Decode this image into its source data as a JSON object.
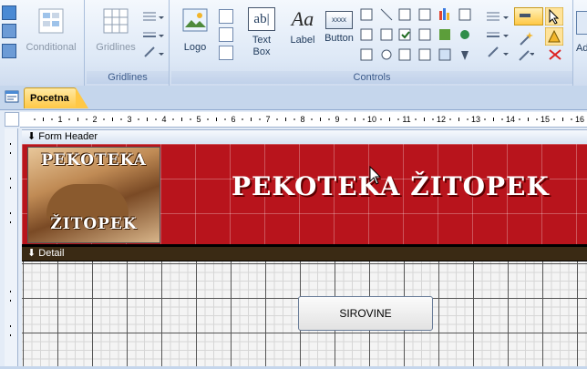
{
  "ribbon": {
    "groups": [
      {
        "label": "",
        "buttons": [
          {
            "label": "Conditional",
            "icon": "conditional-format-icon"
          }
        ]
      },
      {
        "label": "Gridlines",
        "buttons": [
          {
            "label": "Gridlines",
            "icon": "gridlines-icon"
          }
        ]
      },
      {
        "label": "Controls",
        "buttons": [
          {
            "label": "Logo",
            "icon": "logo-icon"
          },
          {
            "label_line1": "Text",
            "label_line2": "Box",
            "icon": "textbox-icon",
            "icon_text": "ab|"
          },
          {
            "label": "Label",
            "icon": "label-icon",
            "icon_text": "Aa"
          },
          {
            "label": "Button",
            "icon": "button-icon",
            "icon_text": "xxxx"
          }
        ]
      },
      {
        "label": "",
        "buttons": [
          {
            "label": "Ad",
            "icon": "add-existing-fields-icon"
          }
        ]
      }
    ]
  },
  "document_tab": {
    "label": "Pocetna"
  },
  "form": {
    "ruler_numbers": [
      "1",
      "2",
      "3",
      "4",
      "5",
      "6",
      "7",
      "8",
      "9",
      "10",
      "11",
      "12",
      "13",
      "14",
      "15",
      "16"
    ],
    "sections": {
      "header": "Form Header",
      "detail": "Detail"
    },
    "logo": {
      "line1": "PEKOTEKA",
      "line2": "ŽITOPEK"
    },
    "title": "PEKOTEKA ŽITOPEK",
    "button": "SIROVINE"
  },
  "colors": {
    "header_bg": "#b8141c",
    "tab_bg": "#ffc845",
    "ribbon_bg": "#dde8f6"
  }
}
